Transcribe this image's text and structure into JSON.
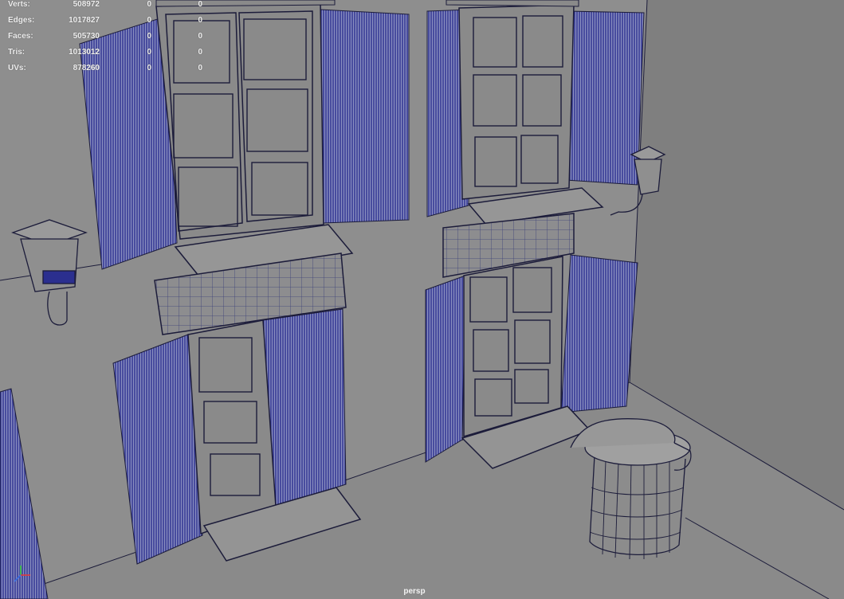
{
  "heads_up_display": {
    "rows": [
      {
        "label": "Verts:",
        "value": "508972",
        "selected": "0",
        "components": "0"
      },
      {
        "label": "Edges:",
        "value": "1017827",
        "selected": "0",
        "components": "0"
      },
      {
        "label": "Faces:",
        "value": "505730",
        "selected": "0",
        "components": "0"
      },
      {
        "label": "Tris:",
        "value": "1013012",
        "selected": "0",
        "components": "0"
      },
      {
        "label": "UVs:",
        "value": "878260",
        "selected": "0",
        "components": "0"
      }
    ]
  },
  "viewport": {
    "camera_label": "persp",
    "background_color": "#8c8c8c",
    "wireframe_color": "#2b2f8f",
    "edge_color": "#1c1c3a"
  }
}
